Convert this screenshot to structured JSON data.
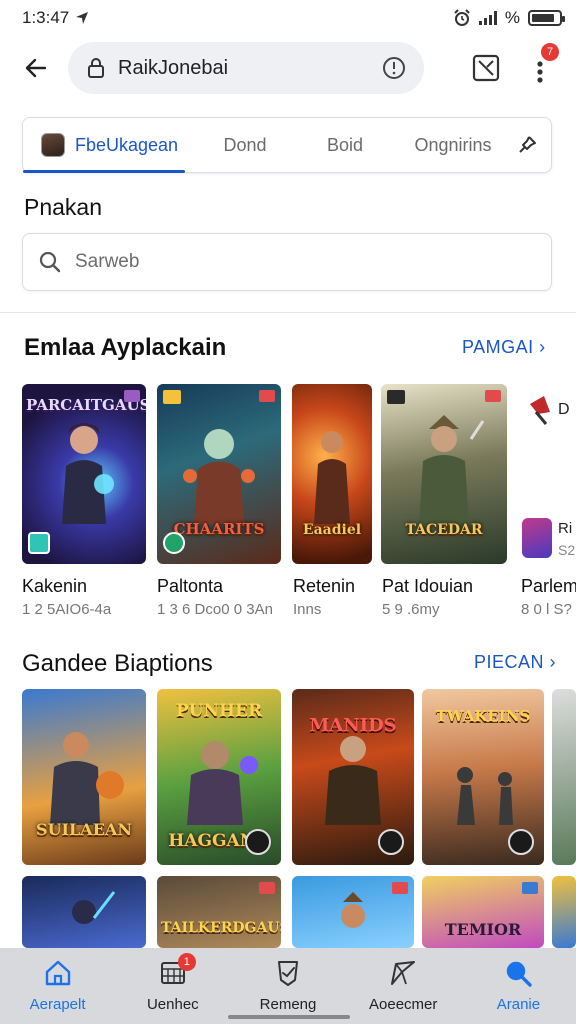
{
  "status_bar": {
    "time": "1:3:47",
    "percent_label": "%"
  },
  "top_bar": {
    "address": "RaikJonebai",
    "menu_badge": "7"
  },
  "tab_strip": {
    "tabs": [
      {
        "label": "FbeUkagean",
        "active": true
      },
      {
        "label": "Dond",
        "active": false
      },
      {
        "label": "Boid",
        "active": false
      },
      {
        "label": "Ongnirins",
        "active": false
      }
    ]
  },
  "page": {
    "heading": "Pnakan"
  },
  "search": {
    "placeholder": "Sarweb"
  },
  "section1": {
    "title": "Emlaa Ayplackain",
    "link": "PAMGAI ›",
    "apps": [
      {
        "name": "Kakenin",
        "meta": "1 2 5AIO6-4a",
        "logo": "PARCAITGAUSI"
      },
      {
        "name": "Paltonta",
        "meta": "1 3 6 Dco0 0 3An",
        "logo": "CHAARITS"
      },
      {
        "name": "Retenin",
        "meta": "Inns",
        "logo": "Eaadiel"
      },
      {
        "name": "Pat Idouian",
        "meta": "5 9 .6my",
        "logo": "TACEDAR"
      },
      {
        "name": "Parlem",
        "meta": "8 0 l S?",
        "logo": ""
      }
    ]
  },
  "section2": {
    "title": "Gandee Biaptions",
    "link": "PIECAN ›",
    "row1_logos": [
      "SUILAEAN",
      "HAGGANG",
      "MANIDS",
      "TWAKEINS"
    ],
    "row1_top_logos": [
      "",
      "PUNHER",
      "",
      ""
    ],
    "row2_logos": [
      "",
      "TAILKERDGAUS",
      "",
      "TEMIOR"
    ]
  },
  "bottom_nav": {
    "items": [
      {
        "label": "Aerapelt",
        "active": true
      },
      {
        "label": "Uenhec",
        "active": false,
        "badge": "1"
      },
      {
        "label": "Remeng",
        "active": false
      },
      {
        "label": "Aoeecmer",
        "active": false
      },
      {
        "label": "Aranie",
        "active": false
      }
    ]
  },
  "colors": {
    "accent": "#1a56c9",
    "badge": "#e53935",
    "nav_bg": "#d8d9dc"
  }
}
